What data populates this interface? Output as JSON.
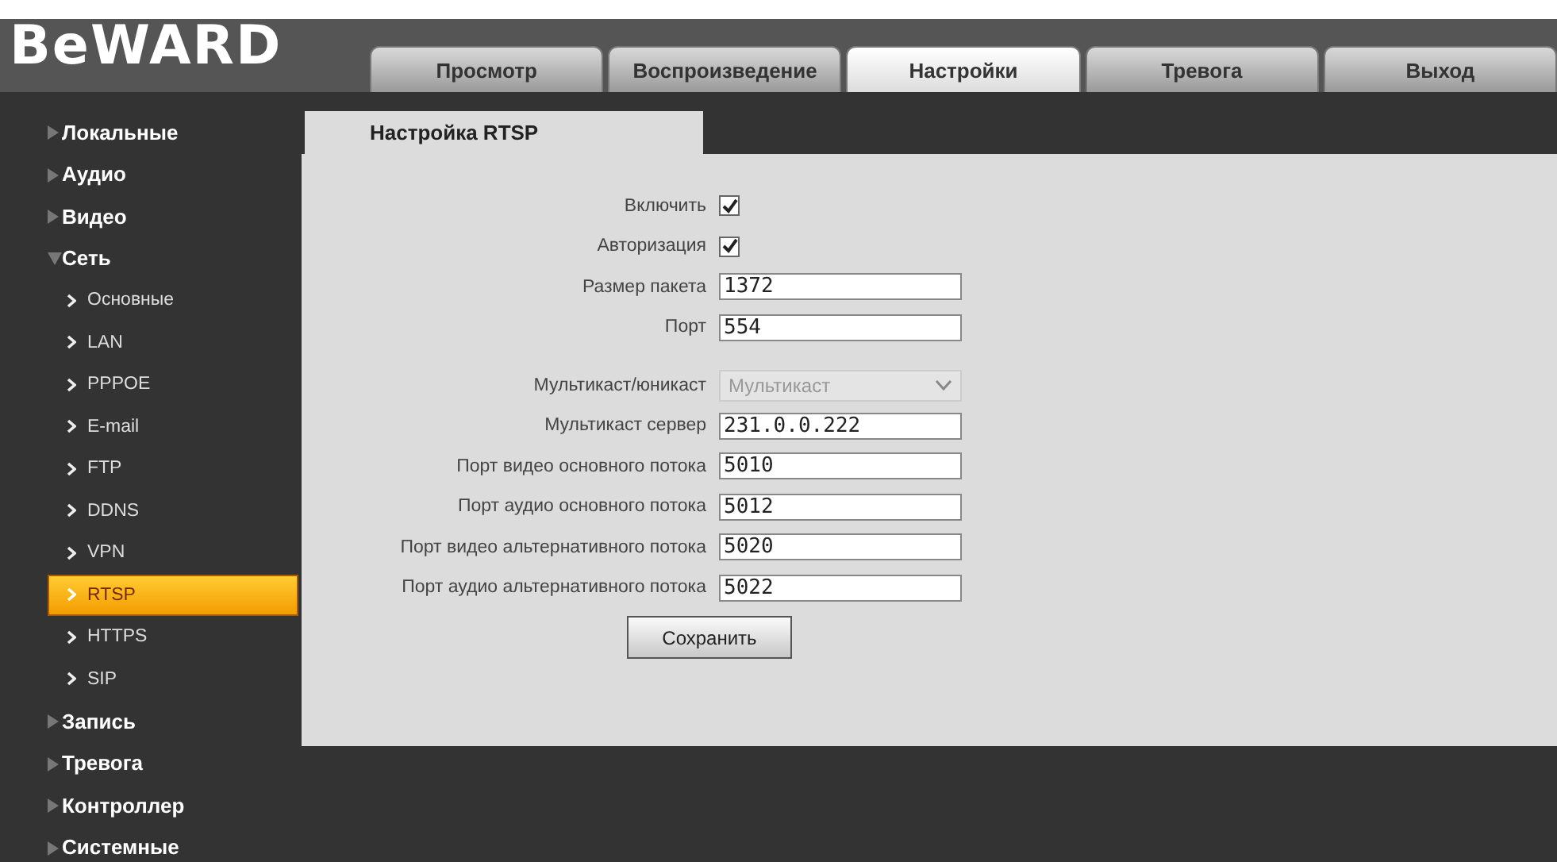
{
  "logo": "BeWARD",
  "tabs": [
    {
      "label": "Просмотр",
      "selected": false
    },
    {
      "label": "Воспроизведение",
      "selected": false
    },
    {
      "label": "Настройки",
      "selected": true
    },
    {
      "label": "Тревога",
      "selected": false
    },
    {
      "label": "Выход",
      "selected": false
    }
  ],
  "sidebar": {
    "items": [
      {
        "label": "Локальные",
        "expanded": false
      },
      {
        "label": "Аудио",
        "expanded": false
      },
      {
        "label": "Видео",
        "expanded": false
      },
      {
        "label": "Сеть",
        "expanded": true,
        "children": [
          {
            "label": "Основные",
            "selected": false
          },
          {
            "label": "LAN",
            "selected": false
          },
          {
            "label": "PPPOE",
            "selected": false
          },
          {
            "label": "E-mail",
            "selected": false
          },
          {
            "label": "FTP",
            "selected": false
          },
          {
            "label": "DDNS",
            "selected": false
          },
          {
            "label": "VPN",
            "selected": false
          },
          {
            "label": "RTSP",
            "selected": true
          },
          {
            "label": "HTTPS",
            "selected": false
          },
          {
            "label": "SIP",
            "selected": false
          }
        ]
      },
      {
        "label": "Запись",
        "expanded": false
      },
      {
        "label": "Тревога",
        "expanded": false
      },
      {
        "label": "Контроллер",
        "expanded": false
      },
      {
        "label": "Системные",
        "expanded": false
      }
    ]
  },
  "panel": {
    "title": "Настройка RTSP",
    "fields": [
      {
        "kind": "checkbox",
        "label": "Включить",
        "checked": true
      },
      {
        "kind": "checkbox",
        "label": "Авторизация",
        "checked": true
      },
      {
        "kind": "text",
        "label": "Размер пакета",
        "value": "1372"
      },
      {
        "kind": "text",
        "label": "Порт",
        "value": "554"
      },
      {
        "kind": "spacer"
      },
      {
        "kind": "select",
        "label": "Мультикаст/юникаст",
        "value": "Мультикаст",
        "disabled": true
      },
      {
        "kind": "text",
        "label": "Мультикаст сервер",
        "value": "231.0.0.222"
      },
      {
        "kind": "text",
        "label": "Порт видео основного потока",
        "value": "5010"
      },
      {
        "kind": "text",
        "label": "Порт аудио основного потока",
        "value": "5012"
      },
      {
        "kind": "text",
        "label": "Порт видео альтернативного потока",
        "value": "5020"
      },
      {
        "kind": "text",
        "label": "Порт аудио альтернативного потока",
        "value": "5022"
      }
    ],
    "save_button": "Сохранить"
  }
}
